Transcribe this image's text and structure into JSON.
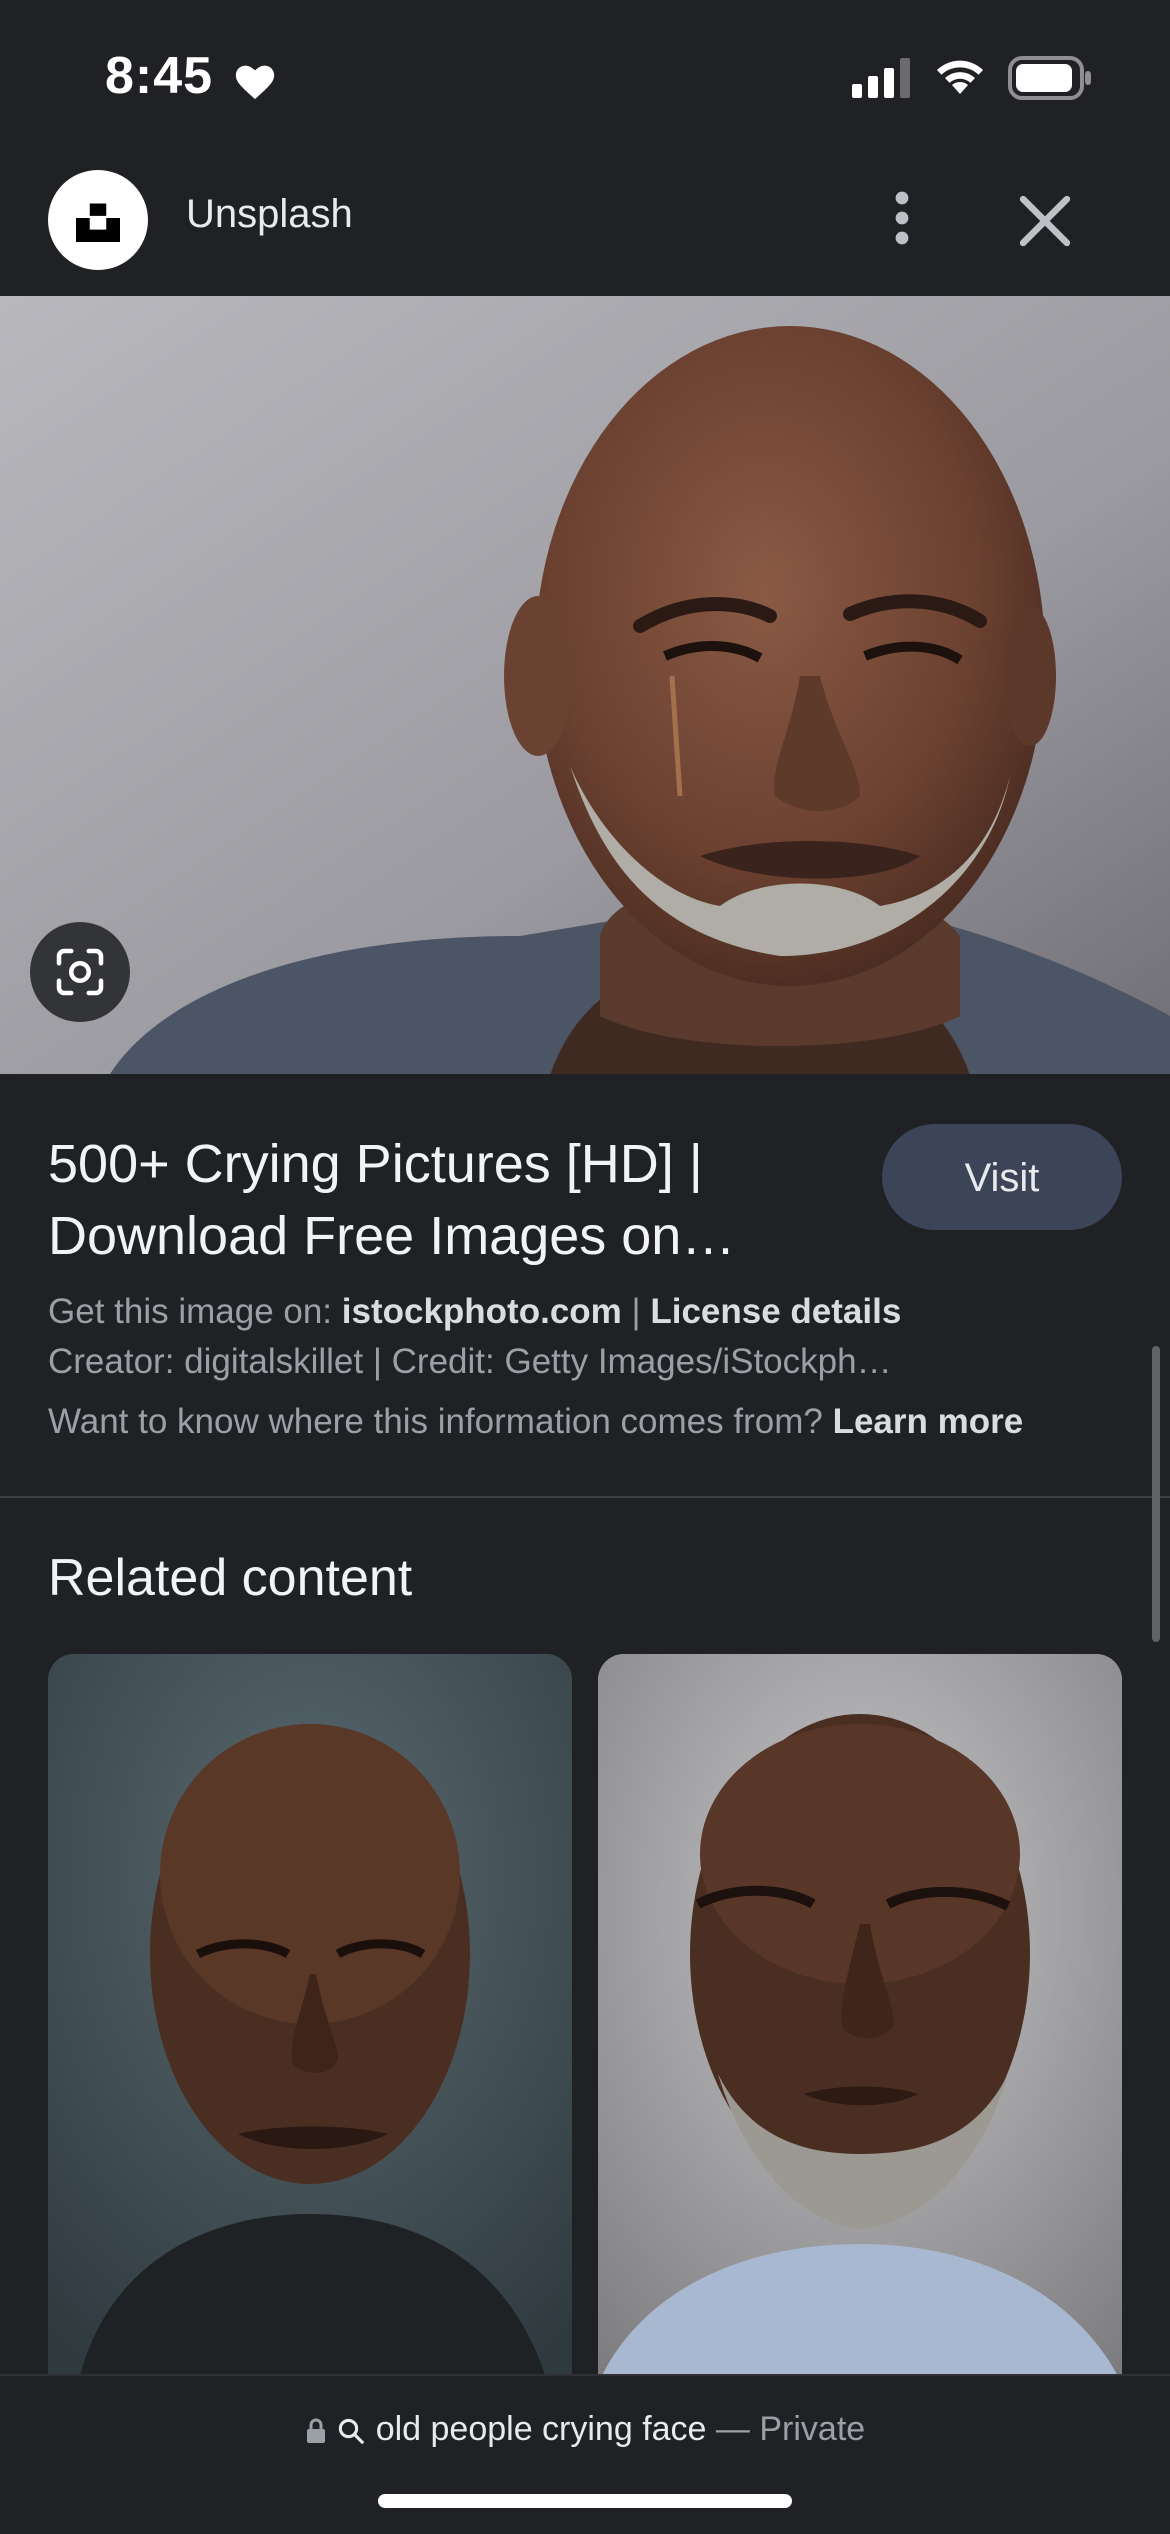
{
  "status_bar": {
    "time": "8:45",
    "icons": [
      "heart-icon",
      "signal-icon",
      "wifi-icon",
      "battery-icon"
    ]
  },
  "header": {
    "site_name": "Unsplash",
    "logo_icon": "unsplash-logo-icon",
    "more_icon": "more-vert-icon",
    "close_icon": "close-icon"
  },
  "hero": {
    "image_description_icon": "photo",
    "lens_icon": "lens-icon"
  },
  "result": {
    "title": "500+ Crying Pictures [HD] | Download Free Images on…",
    "visit_label": "Visit",
    "source_prefix": "Get this image on: ",
    "source_site": "istockphoto.com",
    "separator": " | ",
    "license_label": "License details",
    "credits": "Creator: digitalskillet | Credit: Getty Images/iStockph…",
    "info_question": "Want to know where this information comes from? ",
    "learn_more_label": "Learn more"
  },
  "related": {
    "title": "Related content"
  },
  "bottom_bar": {
    "query": "old people crying face",
    "dash": " — ",
    "private_label": "Private"
  },
  "colors": {
    "background": "#202124",
    "visit_button": "#3c4458",
    "muted_text": "#9aa0a6"
  }
}
